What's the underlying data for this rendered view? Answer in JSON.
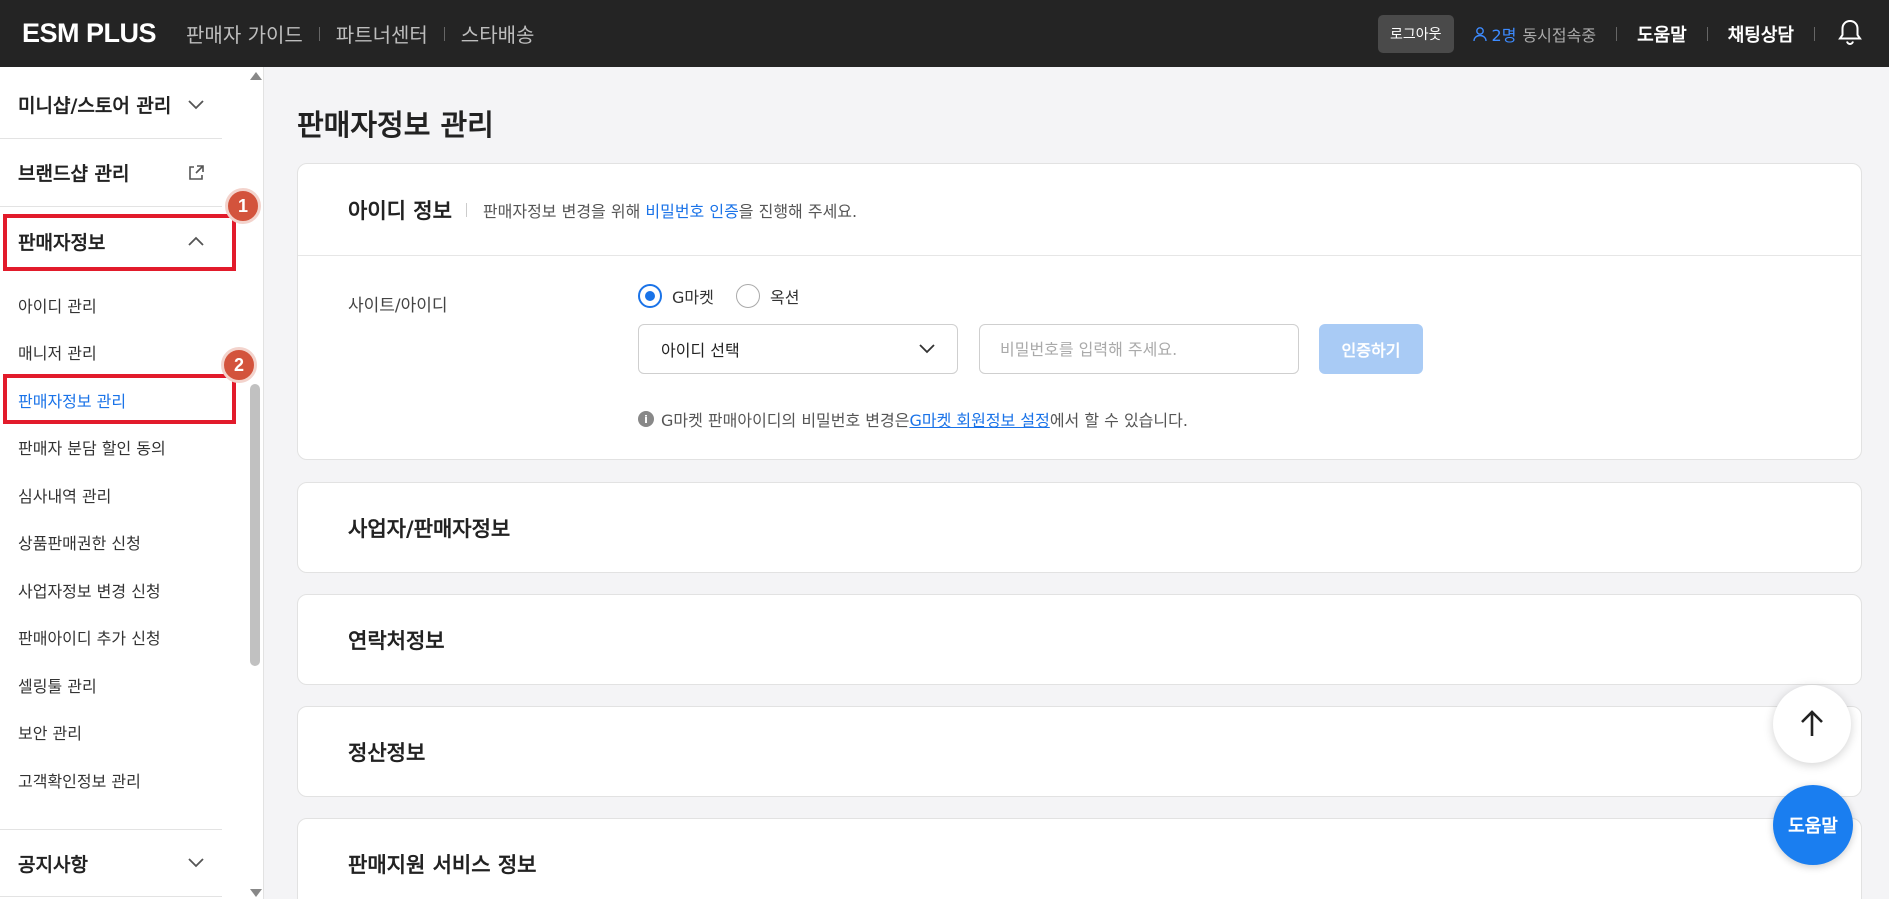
{
  "header": {
    "logo": "ESM PLUS",
    "nav": [
      {
        "label": "판매자 가이드"
      },
      {
        "label": "파트너센터"
      },
      {
        "label": "스타배송"
      }
    ],
    "logout_label": "로그아웃",
    "concurrent_count": "2명",
    "concurrent_text": "동시접속중",
    "help_label": "도움말",
    "chat_label": "채팅상담"
  },
  "sidebar": {
    "top_items": [
      {
        "label": "미니샵/스토어 관리"
      },
      {
        "label": "브랜드샵 관리"
      },
      {
        "label": "판매자정보"
      }
    ],
    "sub_items": [
      {
        "label": "아이디 관리"
      },
      {
        "label": "매니저 관리"
      },
      {
        "label": "판매자정보 관리"
      },
      {
        "label": "판매자 분담 할인 동의"
      },
      {
        "label": "심사내역 관리"
      },
      {
        "label": "상품판매권한 신청"
      },
      {
        "label": "사업자정보 변경 신청"
      },
      {
        "label": "판매아이디 추가 신청"
      },
      {
        "label": "셀링툴 관리"
      },
      {
        "label": "보안 관리"
      },
      {
        "label": "고객확인정보 관리"
      }
    ],
    "bottom_item": {
      "label": "공지사항"
    },
    "badges": [
      "1",
      "2"
    ]
  },
  "main": {
    "title": "판매자정보 관리",
    "id_card": {
      "title": "아이디 정보",
      "desc_before": "판매자정보 변경을 위해 ",
      "desc_link": "비밀번호 인증",
      "desc_after": "을 진행해 주세요.",
      "row_label": "사이트/아이디",
      "radio_gmarket": "G마켓",
      "radio_auction": "옥션",
      "select_value": "아이디 선택",
      "password_placeholder": "비밀번호를 입력해 주세요.",
      "auth_button": "인증하기",
      "notice_before": "G마켓 판매아이디의 비밀번호 변경은 ",
      "notice_link": "G마켓 회원정보 설정",
      "notice_after": "에서 할 수 있습니다."
    },
    "sections": [
      {
        "title": "사업자/판매자정보"
      },
      {
        "title": "연락처정보"
      },
      {
        "title": "정산정보"
      },
      {
        "title": "판매지원 서비스 정보"
      }
    ]
  },
  "floating": {
    "help_label": "도움말"
  },
  "colors": {
    "accent": "#1a73e8",
    "highlight": "#e21b2b",
    "badge": "#d3533c",
    "topbar": "#242424"
  }
}
